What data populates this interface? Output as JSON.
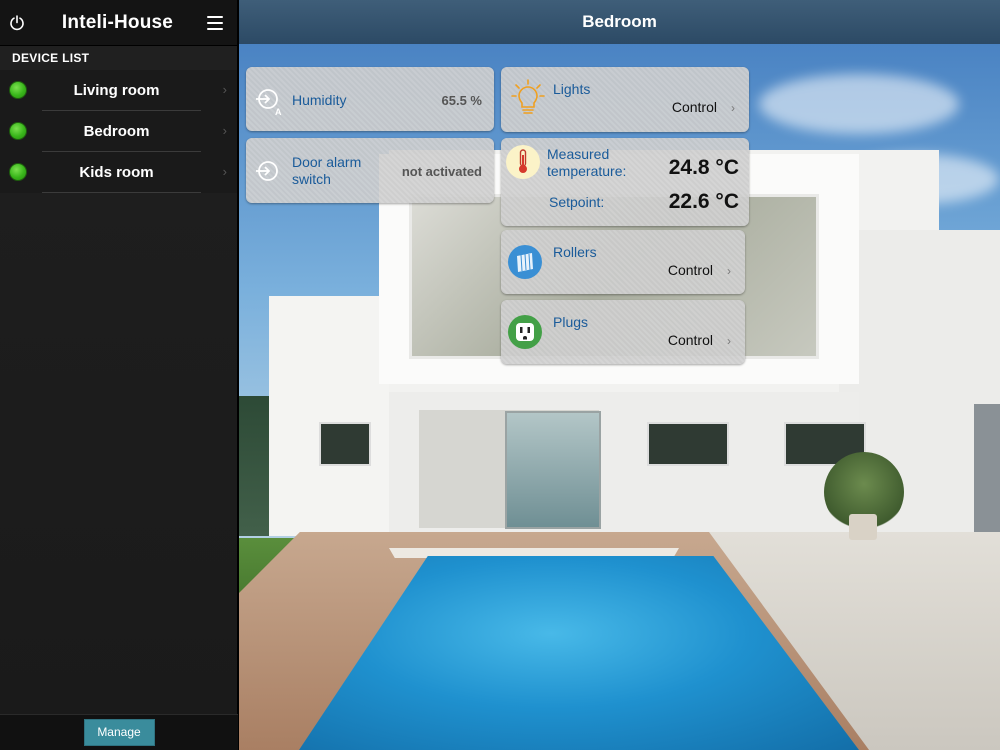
{
  "app": {
    "title": "Inteli-House"
  },
  "sidebar": {
    "section_label": "DEVICE LIST",
    "devices": [
      {
        "name": "Living room",
        "status": "online"
      },
      {
        "name": "Bedroom",
        "status": "online"
      },
      {
        "name": "Kids room",
        "status": "online"
      }
    ],
    "manage_label": "Manage"
  },
  "header": {
    "title": "Bedroom"
  },
  "cards": {
    "humidity": {
      "label": "Humidity",
      "value": "65.5 %",
      "icon": "humidity-sensor-icon"
    },
    "door_alarm": {
      "label": "Door alarm switch",
      "value": "not activated",
      "icon": "door-alarm-icon"
    },
    "lights": {
      "label": "Lights",
      "control": "Control",
      "icon": "lightbulb-icon"
    },
    "temperature": {
      "measured_label": "Measured temperature:",
      "measured_value": "24.8 °C",
      "setpoint_label": "Setpoint:",
      "setpoint_value": "22.6 °C",
      "icon": "thermometer-icon"
    },
    "rollers": {
      "label": "Rollers",
      "control": "Control",
      "icon": "rollers-icon"
    },
    "plugs": {
      "label": "Plugs",
      "control": "Control",
      "icon": "plug-icon"
    }
  },
  "colors": {
    "accent": "#1a5b9a",
    "status_online": "#38b51a",
    "manage_button": "#3a8c9c",
    "header_bar": "#2c4a65"
  }
}
